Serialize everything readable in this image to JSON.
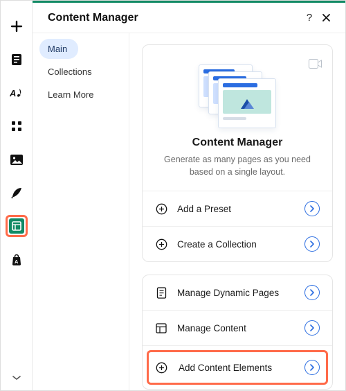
{
  "header": {
    "title": "Content Manager"
  },
  "nav": {
    "items": [
      {
        "label": "Main"
      },
      {
        "label": "Collections"
      },
      {
        "label": "Learn More"
      }
    ]
  },
  "intro": {
    "title": "Content Manager",
    "subtitle": "Generate as many pages as you need based on a single layout."
  },
  "card1": {
    "actions": [
      {
        "label": "Add a Preset"
      },
      {
        "label": "Create a Collection"
      }
    ]
  },
  "card2": {
    "actions": [
      {
        "label": "Manage Dynamic Pages"
      },
      {
        "label": "Manage Content"
      },
      {
        "label": "Add Content Elements"
      }
    ]
  }
}
